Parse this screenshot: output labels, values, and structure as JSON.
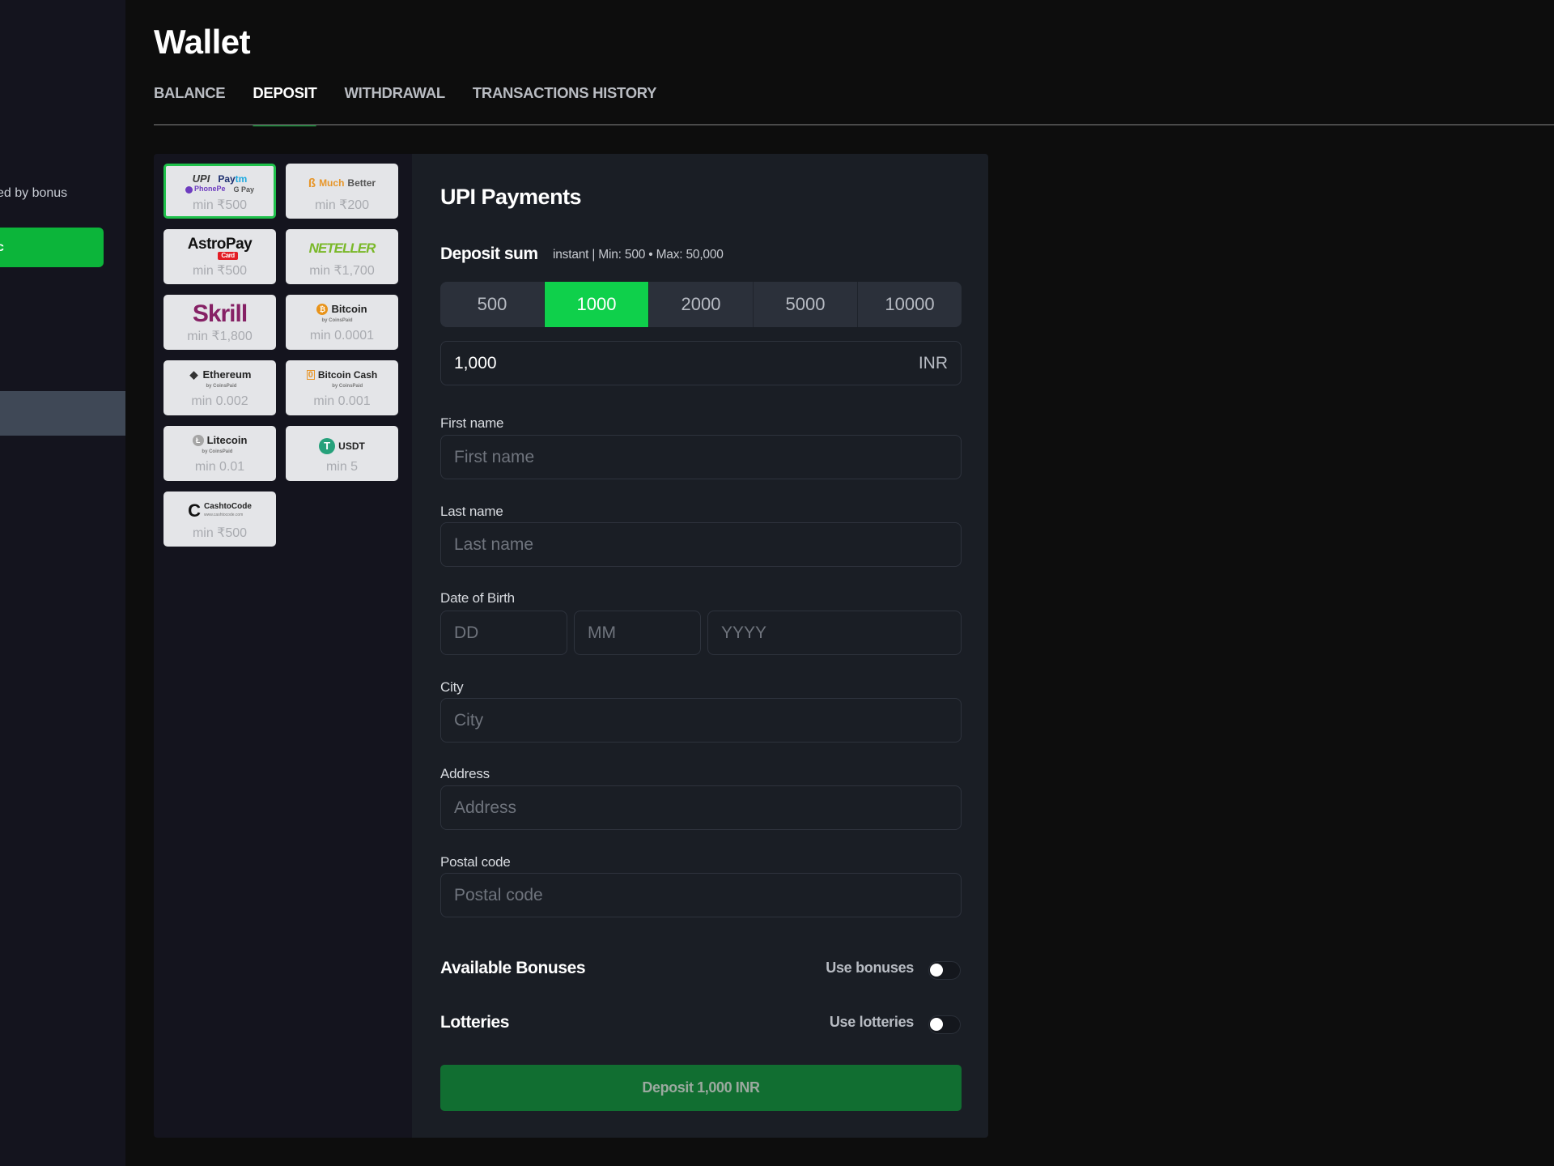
{
  "sidebar": {
    "bonus_text": "ked by bonus",
    "button_label": "c"
  },
  "page_title": "Wallet",
  "tabs": [
    {
      "label": "BALANCE",
      "active": false
    },
    {
      "label": "DEPOSIT",
      "active": true
    },
    {
      "label": "WITHDRAWAL",
      "active": false
    },
    {
      "label": "TRANSACTIONS HISTORY",
      "active": false
    }
  ],
  "payment_methods": [
    {
      "name": "UPI / Paytm / PhonePe / G Pay",
      "logo_parts": [
        "UPI",
        "Pay",
        "tm",
        "PhonePe",
        "G Pay"
      ],
      "min": "min ₹500",
      "selected": true
    },
    {
      "name": "MuchBetter",
      "logo_parts": [
        "Much",
        "Better"
      ],
      "min": "min ₹200",
      "selected": false
    },
    {
      "name": "AstroPay",
      "logo_parts": [
        "AstroPay",
        "Card"
      ],
      "min": "min ₹500",
      "selected": false
    },
    {
      "name": "NETELLER",
      "logo_parts": [
        "NETELLER"
      ],
      "min": "min ₹1,700",
      "selected": false
    },
    {
      "name": "Skrill",
      "logo_parts": [
        "Skrill"
      ],
      "min": "min ₹1,800",
      "selected": false
    },
    {
      "name": "Bitcoin",
      "logo_parts": [
        "Bitcoin",
        "by CoinsPaid"
      ],
      "min": "min 0.0001",
      "selected": false
    },
    {
      "name": "Ethereum",
      "logo_parts": [
        "Ethereum",
        "by CoinsPaid"
      ],
      "min": "min 0.002",
      "selected": false
    },
    {
      "name": "Bitcoin Cash",
      "logo_parts": [
        "Bitcoin Cash",
        "by CoinsPaid"
      ],
      "min": "min 0.001",
      "selected": false
    },
    {
      "name": "Litecoin",
      "logo_parts": [
        "Litecoin",
        "by CoinsPaid"
      ],
      "min": "min 0.01",
      "selected": false
    },
    {
      "name": "USDT",
      "logo_parts": [
        "USDT"
      ],
      "min": "min 5",
      "selected": false
    },
    {
      "name": "CashtoCode",
      "logo_parts": [
        "CashtoCode",
        "www.cashtocode.com"
      ],
      "min": "min ₹500",
      "selected": false
    }
  ],
  "form": {
    "title": "UPI Payments",
    "deposit_sum_label": "Deposit sum",
    "deposit_sum_hint": "instant | Min: 500 • Max: 50,000",
    "amount_options": [
      "500",
      "1000",
      "2000",
      "5000",
      "10000"
    ],
    "selected_amount": "1000",
    "amount_value": "1,000",
    "currency": "INR",
    "fields": {
      "first_name": {
        "label": "First name",
        "placeholder": "First name",
        "value": ""
      },
      "last_name": {
        "label": "Last name",
        "placeholder": "Last name",
        "value": ""
      },
      "dob": {
        "label": "Date of Birth",
        "dd_placeholder": "DD",
        "mm_placeholder": "MM",
        "yyyy_placeholder": "YYYY"
      },
      "city": {
        "label": "City",
        "placeholder": "City",
        "value": ""
      },
      "address": {
        "label": "Address",
        "placeholder": "Address",
        "value": ""
      },
      "postal_code": {
        "label": "Postal code",
        "placeholder": "Postal code",
        "value": ""
      }
    },
    "bonuses": {
      "title": "Available Bonuses",
      "toggle_label": "Use bonuses",
      "enabled": false
    },
    "lotteries": {
      "title": "Lotteries",
      "toggle_label": "Use lotteries",
      "enabled": false
    },
    "submit_label": "Deposit 1,000 INR"
  },
  "colors": {
    "accent_green": "#0fd04b",
    "selected_border": "#1fc14b",
    "submit_green": "#116e31",
    "panel_bg": "#1a1e25",
    "page_bg": "#0d0d0d"
  }
}
